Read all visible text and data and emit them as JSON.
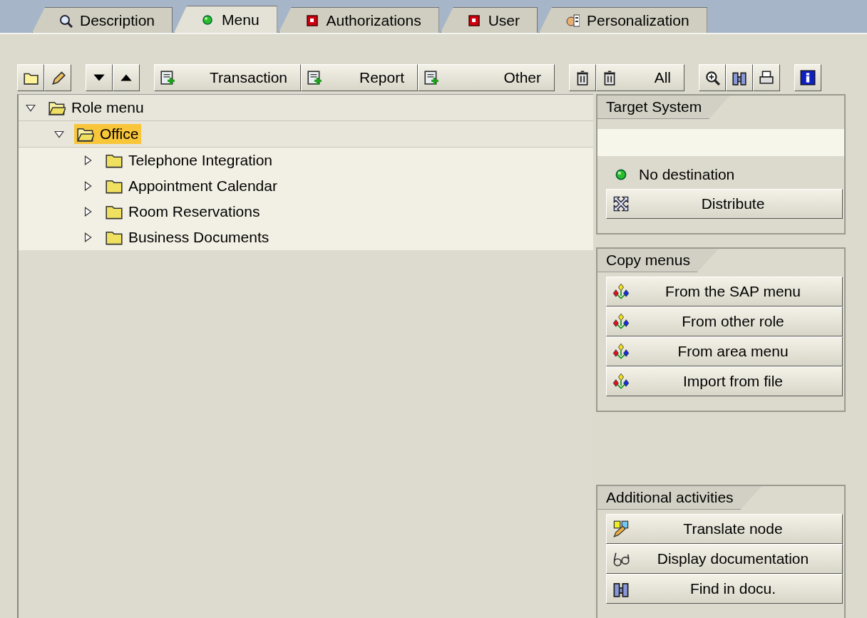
{
  "tabs": [
    {
      "label": "Description",
      "kind": "magnifier",
      "selected": false
    },
    {
      "label": "Menu",
      "kind": "green",
      "selected": true
    },
    {
      "label": "Authorizations",
      "kind": "red",
      "selected": false
    },
    {
      "label": "User",
      "kind": "red",
      "selected": false
    },
    {
      "label": "Personalization",
      "kind": "person",
      "selected": false
    }
  ],
  "toolbar": [
    [
      {
        "kind": "folder"
      },
      {
        "kind": "pencil"
      }
    ],
    [
      {
        "kind": "down"
      },
      {
        "kind": "up"
      }
    ],
    [
      {
        "kind": "add",
        "label": "Transaction"
      },
      {
        "kind": "add",
        "label": "Report"
      },
      {
        "kind": "add",
        "label": "Other"
      }
    ],
    [
      {
        "kind": "trash"
      },
      {
        "kind": "trash",
        "label": "All"
      }
    ],
    [
      {
        "kind": "zoom"
      },
      {
        "kind": "binoculars"
      },
      {
        "kind": "print"
      }
    ],
    [
      {
        "kind": "info"
      }
    ]
  ],
  "tree": [
    {
      "label": "Role menu",
      "expanded": true,
      "selected": false,
      "children": [
        {
          "label": "Office",
          "expanded": true,
          "selected": true,
          "children": [
            {
              "label": "Telephone Integration",
              "expanded": false,
              "selected": false
            },
            {
              "label": "Appointment Calendar",
              "expanded": false,
              "selected": false
            },
            {
              "label": "Room Reservations",
              "expanded": false,
              "selected": false
            },
            {
              "label": "Business Documents",
              "expanded": false,
              "selected": false
            }
          ]
        }
      ]
    }
  ],
  "target_system": {
    "title": "Target System",
    "status": "No destination",
    "buttons": [
      {
        "kind": "distribute",
        "label": "Distribute"
      }
    ]
  },
  "copy_menus": {
    "title": "Copy menus",
    "buttons": [
      {
        "kind": "hierarchy",
        "label": "From the SAP menu"
      },
      {
        "kind": "hierarchy",
        "label": "From other role"
      },
      {
        "kind": "hierarchy",
        "label": "From area menu"
      },
      {
        "kind": "hierarchy",
        "label": "Import from file"
      }
    ]
  },
  "additional_activities": {
    "title": "Additional activities",
    "buttons": [
      {
        "kind": "translate",
        "label": "Translate node"
      },
      {
        "kind": "glasses",
        "label": "Display documentation"
      },
      {
        "kind": "binoculars",
        "label": "Find in docu."
      }
    ]
  }
}
